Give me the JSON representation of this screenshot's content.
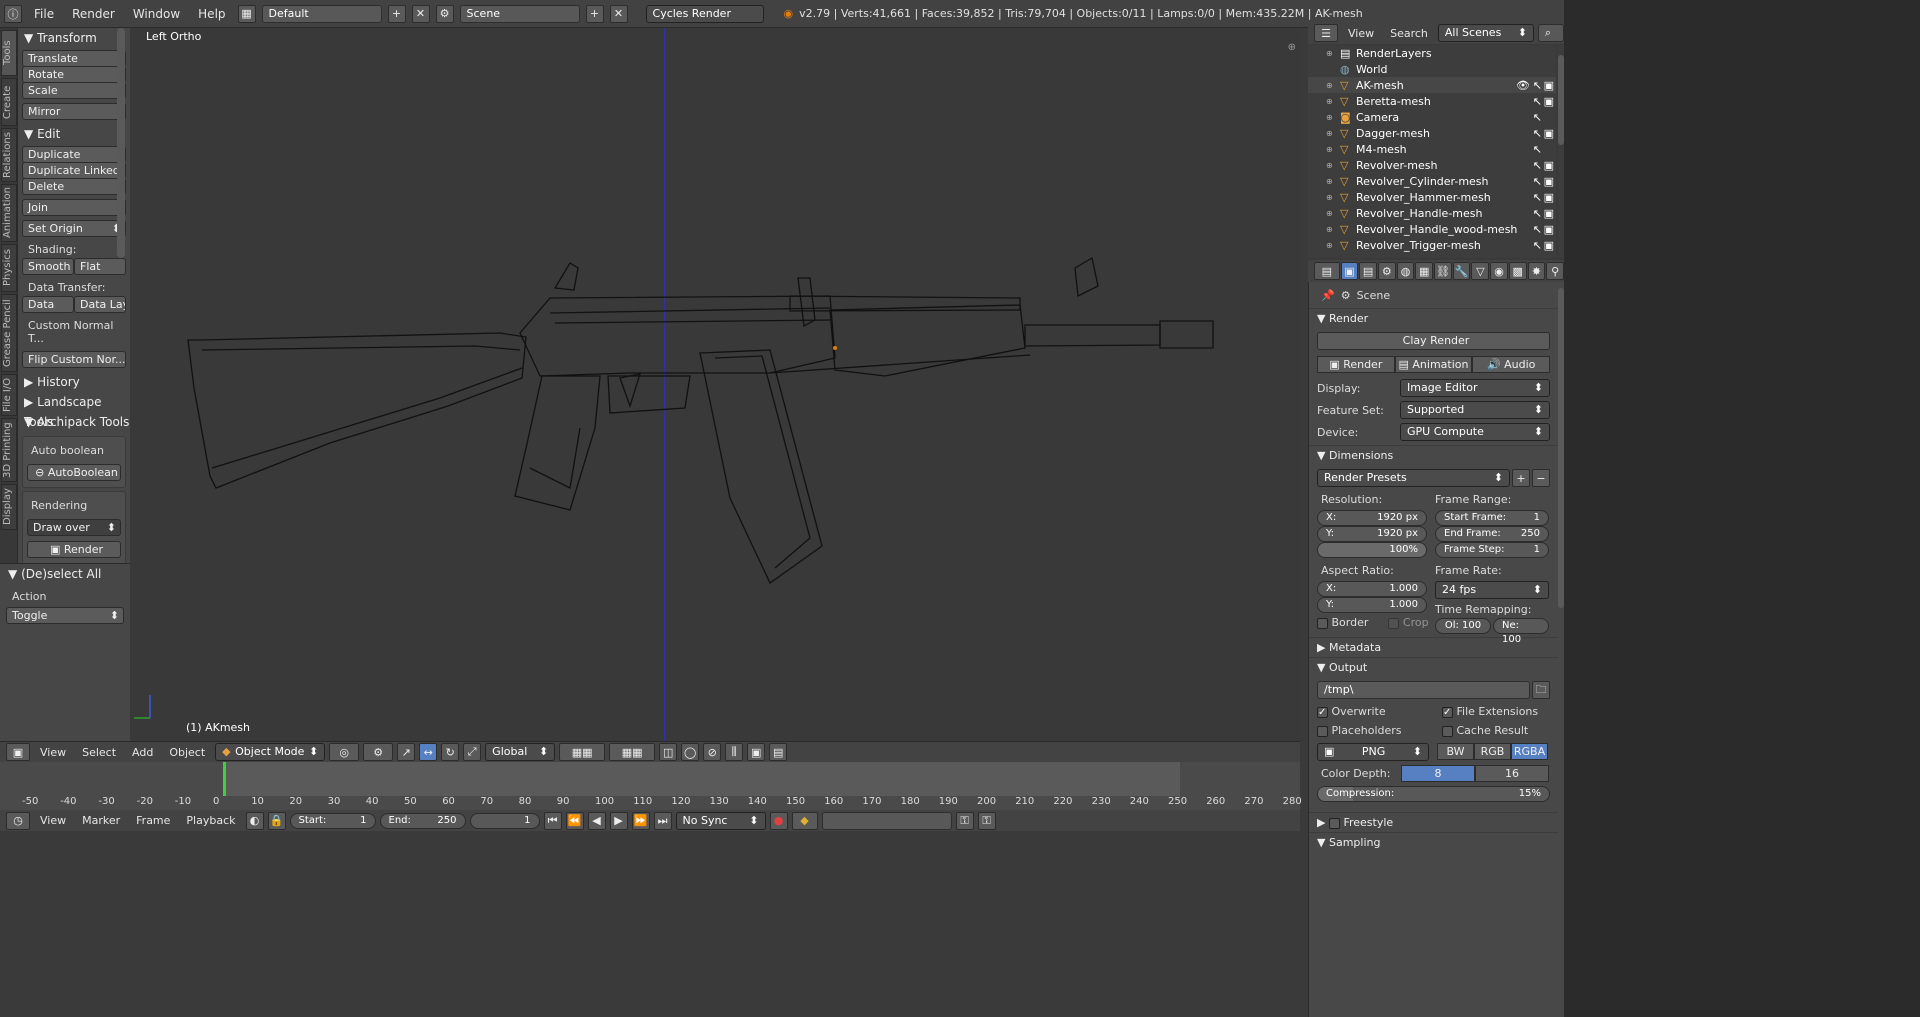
{
  "topbar": {
    "menus": [
      "File",
      "Render",
      "Window",
      "Help"
    ],
    "layout": "Default",
    "scene": "Scene",
    "engine": "Cycles Render",
    "status": "v2.79 | Verts:41,661 | Faces:39,852 | Tris:79,704 | Objects:0/11 | Lamps:0/0 | Mem:435.22M | AK-mesh"
  },
  "tabs": [
    "Tools",
    "Create",
    "Relations",
    "Animation",
    "Physics",
    "Grease Pencil",
    "File I/O",
    "3D Printing",
    "Display"
  ],
  "shelf": {
    "transform": {
      "title": "Transform",
      "buttons": [
        "Translate",
        "Rotate",
        "Scale",
        "Mirror"
      ]
    },
    "edit": {
      "title": "Edit",
      "buttons": [
        "Duplicate",
        "Duplicate Linked",
        "Delete",
        "Join"
      ],
      "set_origin": "Set Origin",
      "shading_label": "Shading:",
      "smooth": "Smooth",
      "flat": "Flat",
      "data_transfer_label": "Data Transfer:",
      "data": "Data",
      "data_lay": "Data Lay",
      "custom_normal": "Custom Normal T...",
      "flip_custom": "Flip Custom Nor..."
    },
    "history": "History",
    "landscape": "Landscape Tools",
    "archipack": "Archipack Tools",
    "auto_boolean_label": "Auto boolean",
    "auto_boolean_btn": "AutoBoolean",
    "rendering_label": "Rendering",
    "draw_over": "Draw over",
    "render_btn": "Render"
  },
  "operator": {
    "title": "(De)select All",
    "action_label": "Action",
    "action_value": "Toggle"
  },
  "viewport": {
    "view_name": "Left Ortho",
    "object_label": "(1) AKmesh"
  },
  "vheader": {
    "menus": [
      "View",
      "Select",
      "Add",
      "Object"
    ],
    "mode": "Object Mode",
    "orientation": "Global"
  },
  "timeline": {
    "ticks": [
      "-50",
      "-40",
      "-30",
      "-20",
      "-10",
      "0",
      "10",
      "20",
      "30",
      "40",
      "50",
      "60",
      "70",
      "80",
      "90",
      "100",
      "110",
      "120",
      "130",
      "140",
      "150",
      "160",
      "170",
      "180",
      "190",
      "200",
      "210",
      "220",
      "230",
      "240",
      "250",
      "260",
      "270",
      "280"
    ],
    "menus": [
      "View",
      "Marker",
      "Frame",
      "Playback"
    ],
    "start_label": "Start:",
    "start": "1",
    "end_label": "End:",
    "end": "250",
    "current": "1",
    "sync": "No Sync"
  },
  "outliner": {
    "menus": [
      "View",
      "Search"
    ],
    "filter": "All Scenes",
    "items": [
      {
        "name": "RenderLayers",
        "icon": "renderlayer-icon"
      },
      {
        "name": "World",
        "icon": "world-icon"
      },
      {
        "name": "AK-mesh",
        "icon": "mesh-icon"
      },
      {
        "name": "Beretta-mesh",
        "icon": "mesh-icon"
      },
      {
        "name": "Camera",
        "icon": "camera-icon"
      },
      {
        "name": "Dagger-mesh",
        "icon": "mesh-icon"
      },
      {
        "name": "M4-mesh",
        "icon": "mesh-icon"
      },
      {
        "name": "Revolver-mesh",
        "icon": "mesh-icon"
      },
      {
        "name": "Revolver_Cylinder-mesh",
        "icon": "mesh-icon"
      },
      {
        "name": "Revolver_Hammer-mesh",
        "icon": "mesh-icon"
      },
      {
        "name": "Revolver_Handle-mesh",
        "icon": "mesh-icon"
      },
      {
        "name": "Revolver_Handle_wood-mesh",
        "icon": "mesh-icon"
      },
      {
        "name": "Revolver_Trigger-mesh",
        "icon": "mesh-icon"
      }
    ]
  },
  "props": {
    "context": "Scene",
    "render": {
      "title": "Render",
      "clay": "Clay Render",
      "tabs": [
        "Render",
        "Animation",
        "Audio"
      ],
      "display_label": "Display:",
      "display": "Image Editor",
      "feature_label": "Feature Set:",
      "feature": "Supported",
      "device_label": "Device:",
      "device": "GPU Compute"
    },
    "dimensions": {
      "title": "Dimensions",
      "presets": "Render Presets",
      "res_label": "Resolution:",
      "x_label": "X:",
      "x": "1920 px",
      "y_label": "Y:",
      "y": "1920 px",
      "pct": "100%",
      "fr_label": "Frame Range:",
      "start_label": "Start Frame:",
      "start": "1",
      "end_label": "End Frame:",
      "end": "250",
      "step_label": "Frame Step:",
      "step": "1",
      "aspect_label": "Aspect Ratio:",
      "ax": "1.000",
      "ay": "1.000",
      "rate_label": "Frame Rate:",
      "rate": "24 fps",
      "remap_label": "Time Remapping:",
      "old": "Ol: 100",
      "new": "Ne: 100",
      "border": "Border",
      "crop": "Crop"
    },
    "metadata": "Metadata",
    "output": {
      "title": "Output",
      "path": "/tmp\\",
      "overwrite": "Overwrite",
      "file_ext": "File Extensions",
      "placeholders": "Placeholders",
      "cache": "Cache Result",
      "format": "PNG",
      "bw": "BW",
      "rgb": "RGB",
      "rgba": "RGBA",
      "depth_label": "Color Depth:",
      "d8": "8",
      "d16": "16",
      "compression_label": "Compression:",
      "compression": "15%"
    },
    "freestyle": "Freestyle",
    "sampling": "Sampling"
  }
}
